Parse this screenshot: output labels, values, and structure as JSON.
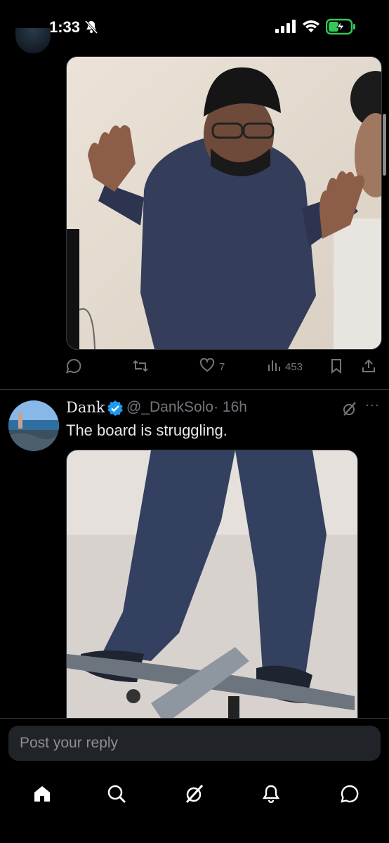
{
  "status_bar": {
    "time": "1:33",
    "icons": [
      "bell-slash-icon",
      "signal-icon",
      "wifi-icon",
      "battery-charging-icon"
    ]
  },
  "tweet1": {
    "image_alt": "",
    "actions": {
      "reply_count": "",
      "retweet_count": "",
      "like_count": "7",
      "views_count": "453"
    }
  },
  "tweet2": {
    "display_name": "Dank",
    "handle": "@_DankSolo",
    "time": "· 16h",
    "text": "The board is struggling.",
    "more_label": "···"
  },
  "reply": {
    "placeholder": "Post your reply"
  },
  "tabbar": {
    "items": [
      "home-icon",
      "search-icon",
      "grok-icon",
      "notifications-icon",
      "messages-icon"
    ]
  },
  "colors": {
    "background": "#000000",
    "text": "#e7e9ea",
    "muted": "#71767b",
    "verified": "#1d9bf0",
    "input_bg": "#202327"
  }
}
